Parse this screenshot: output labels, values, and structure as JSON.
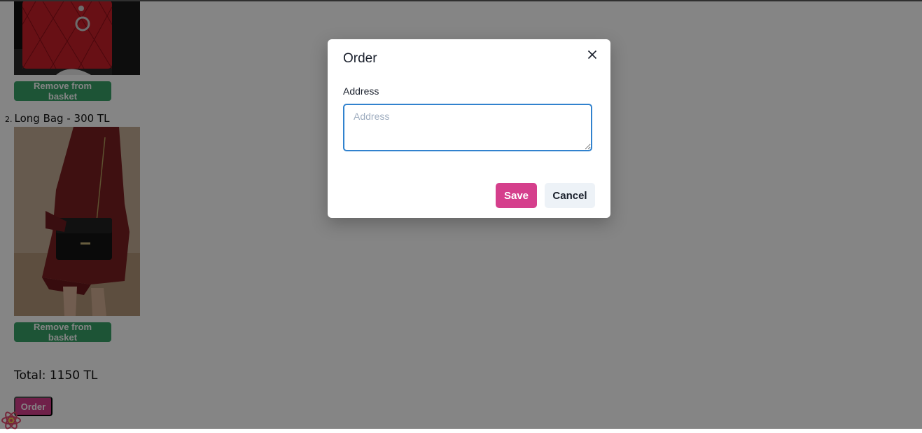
{
  "basket": {
    "items": [
      {
        "label": "",
        "remove_label": "Remove from basket"
      },
      {
        "number": "2.",
        "label": "Long Bag - 300 TL",
        "remove_label": "Remove from basket"
      }
    ],
    "total": "Total: 1150 TL",
    "order_label": "Order"
  },
  "modal": {
    "title": "Order",
    "address_label": "Address",
    "address_placeholder": "Address",
    "address_value": "",
    "save_label": "Save",
    "cancel_label": "Cancel"
  },
  "colors": {
    "save": "#d53f8c",
    "remove": "#38a169",
    "focus_border": "#3182ce"
  }
}
